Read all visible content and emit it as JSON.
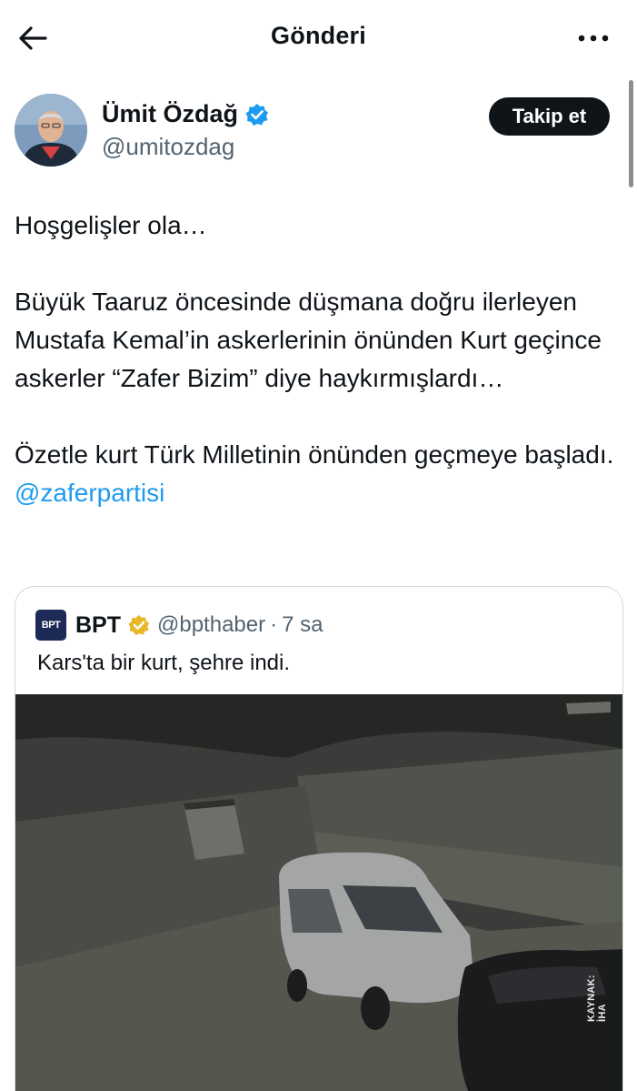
{
  "header": {
    "title": "Gönderi",
    "back_icon": "arrow-left-icon",
    "more_icon": "more-horizontal-icon"
  },
  "author": {
    "display_name": "Ümit Özdağ",
    "handle": "@umitozdag",
    "verified": true,
    "verified_color": "#1d9bf0",
    "follow_label": "Takip et"
  },
  "tweet": {
    "paragraphs": [
      "Hoşgelişler ola…",
      "Büyük Taaruz öncesinde düşmana doğru ilerleyen Mustafa Kemal’in askerlerinin önünden Kurt geçince askerler “Zafer Bizim” diye haykırmışlardı…",
      "Özetle kurt Türk Milletinin önünden geçmeye başladı."
    ],
    "mention": "@zaferpartisi",
    "mention_color": "#1d9bf0"
  },
  "quote": {
    "avatar_text": "BPT",
    "name": "BPT",
    "verified_badge_color": "#e8b828",
    "handle": "@bpthaber",
    "separator": "·",
    "time": "7 sa",
    "text": "Kars'ta bir kurt, şehre indi.",
    "media_watermark": "KAYNAK: İHA"
  }
}
